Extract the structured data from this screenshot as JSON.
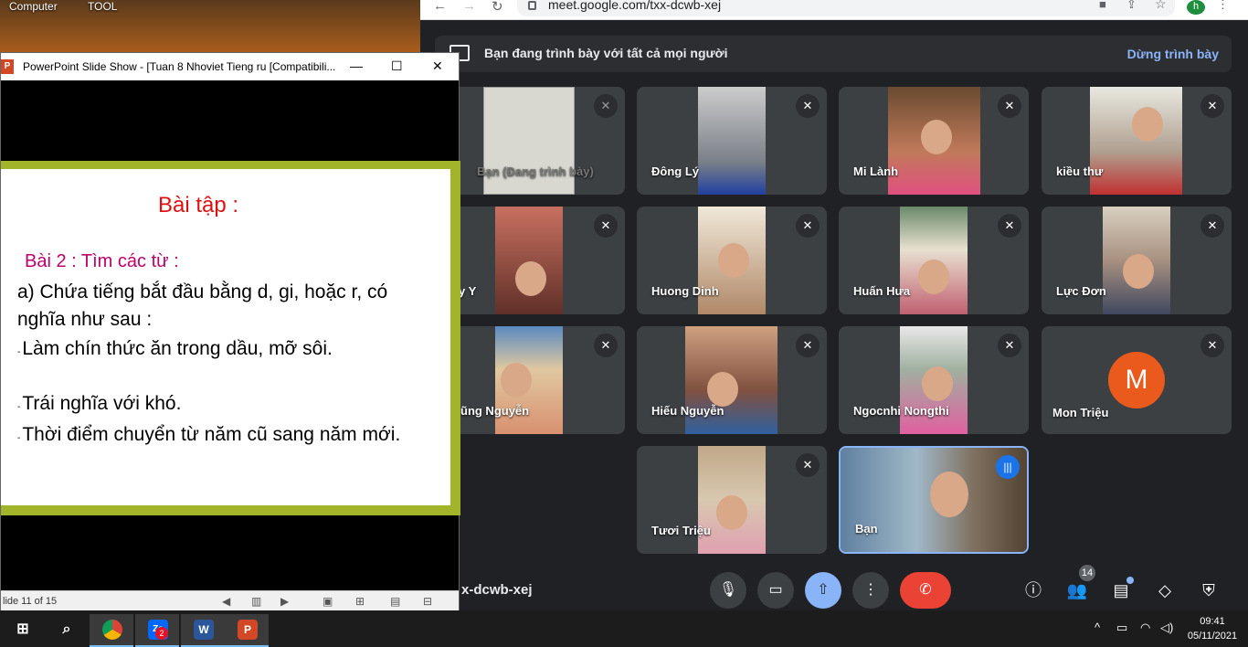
{
  "desktop": {
    "icons": [
      "Computer",
      "TOOL"
    ]
  },
  "browser": {
    "url": "meet.google.com/txx-dcwb-xej",
    "profile_initial": "h"
  },
  "meet": {
    "presenting_text": "Bạn đang trình bày với tất cả mọi người",
    "stop_presenting": "Dừng trình bày",
    "meeting_code": "x-dcwb-xej",
    "participant_count": "14",
    "tiles": [
      {
        "name": "Bạn (Đang trình bày)"
      },
      {
        "name": "Đông Lý"
      },
      {
        "name": "Mi Lành"
      },
      {
        "name": "kiều thư"
      },
      {
        "name": "y Y"
      },
      {
        "name": "Huong Dinh"
      },
      {
        "name": "Huấn Hưa"
      },
      {
        "name": "Lực Đơn"
      },
      {
        "name": "ũng Nguyễn"
      },
      {
        "name": "Hiếu Nguyễn"
      },
      {
        "name": "Ngocnhi Nongthi"
      },
      {
        "name": "Mon Triệu",
        "avatar_letter": "M"
      },
      {
        "name": "Tươi Triệu"
      },
      {
        "name": "Bạn"
      }
    ],
    "colors": {
      "end_call": "#ea4335",
      "present_active": "#8ab4f8",
      "avatar_m": "#ea5a1c"
    }
  },
  "ppt": {
    "window_title": "PowerPoint Slide Show - [Tuan 8 Nhoviet Tieng ru [Compatibili...",
    "app_icon_letter": "P",
    "slide": {
      "title": "Bài tập :",
      "subtitle": "Bài 2 : Tìm các từ :",
      "line_a": "a) Chứa tiếng bắt đầu bằng d, gi, hoặc r, có nghĩa như sau :",
      "bullet_1": "Làm chín thức ăn trong dầu, mỡ sôi.",
      "bullet_2": "Trái nghĩa với khó.",
      "bullet_3": "Thời điểm chuyển từ năm cũ sang năm mới."
    },
    "status": "lide 11 of 15"
  },
  "taskbar": {
    "zalo_badge": "2",
    "word_letter": "W",
    "ppt_letter": "P",
    "zalo_letter": "Za",
    "time": "09:41",
    "date": "05/11/2021"
  }
}
